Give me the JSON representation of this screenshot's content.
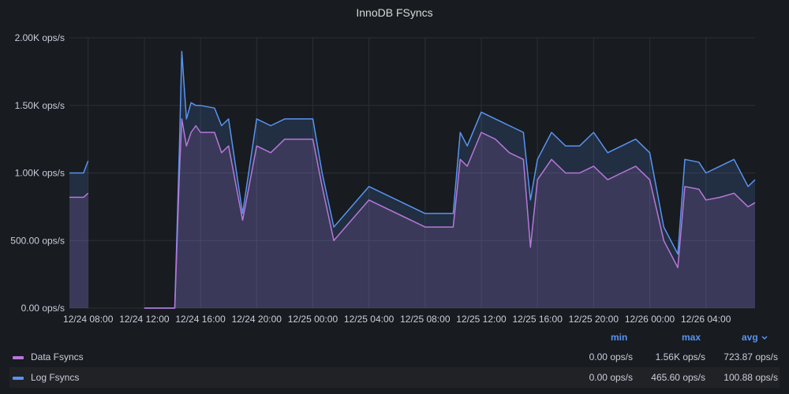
{
  "panel": {
    "title": "InnoDB FSyncs"
  },
  "legend": {
    "headers": {
      "min": "min",
      "max": "max",
      "avg": "avg",
      "avg_icon": "chevron-down-icon"
    },
    "rows": [
      {
        "name": "Data Fsyncs",
        "color": "#b877d9",
        "min": "0.00 ops/s",
        "max": "1.56K ops/s",
        "avg": "723.87 ops/s"
      },
      {
        "name": "Log Fsyncs",
        "color": "#5794f2",
        "min": "0.00 ops/s",
        "max": "465.60 ops/s",
        "avg": "100.88 ops/s"
      }
    ]
  },
  "chart_data": {
    "type": "area",
    "title": "InnoDB FSyncs",
    "y_tick_labels": [
      "0.00 ops/s",
      "500.00 ops/s",
      "1.00K ops/s",
      "1.50K ops/s",
      "2.00K ops/s"
    ],
    "ylim": [
      0,
      2000
    ],
    "x_range": [
      "12/24 06:40",
      "12/26 07:30"
    ],
    "x_tick_labels": [
      "12/24 08:00",
      "12/24 12:00",
      "12/24 16:00",
      "12/24 20:00",
      "12/25 00:00",
      "12/25 04:00",
      "12/25 08:00",
      "12/25 12:00",
      "12/25 16:00",
      "12/25 20:00",
      "12/26 00:00",
      "12/26 04:00"
    ],
    "grid": true,
    "legend_position": "bottom",
    "series": [
      {
        "name": "Log Fsyncs",
        "color": "#5794f2",
        "x": [
          "12/24 06:40",
          "12/24 07:40",
          "12/24 08:00",
          "12/24 08:20",
          "12/24 12:00",
          "12/24 14:10",
          "12/24 14:30",
          "12/24 14:40",
          "12/24 15:00",
          "12/24 15:20",
          "12/24 15:40",
          "12/24 16:00",
          "12/24 17:00",
          "12/24 17:30",
          "12/24 18:00",
          "12/24 19:00",
          "12/24 20:00",
          "12/24 21:00",
          "12/24 22:00",
          "12/24 23:00",
          "12/25 00:00",
          "12/25 00:40",
          "12/25 01:30",
          "12/25 04:00",
          "12/25 08:00",
          "12/25 10:00",
          "12/25 10:30",
          "12/25 11:00",
          "12/25 12:00",
          "12/25 13:00",
          "12/25 14:00",
          "12/25 15:00",
          "12/25 15:30",
          "12/25 16:00",
          "12/25 17:00",
          "12/25 18:00",
          "12/25 19:00",
          "12/25 20:00",
          "12/25 21:00",
          "12/25 22:00",
          "12/25 23:00",
          "12/26 00:00",
          "12/26 01:00",
          "12/26 02:00",
          "12/26 02:30",
          "12/26 03:30",
          "12/26 04:00",
          "12/26 05:00",
          "12/26 06:00",
          "12/26 07:00",
          "12/26 07:30"
        ],
        "y": [
          1000,
          1000,
          1090,
          null,
          0,
          0,
          1200,
          1900,
          1400,
          1520,
          1500,
          1500,
          1480,
          1350,
          1400,
          700,
          1400,
          1350,
          1400,
          1400,
          1400,
          1000,
          600,
          900,
          700,
          700,
          1300,
          1200,
          1450,
          1400,
          1350,
          1300,
          800,
          1100,
          1300,
          1200,
          1200,
          1300,
          1150,
          1200,
          1250,
          1150,
          600,
          400,
          1100,
          1080,
          1000,
          1050,
          1100,
          900,
          950
        ]
      },
      {
        "name": "Data Fsyncs",
        "color": "#b877d9",
        "x": [
          "12/24 06:40",
          "12/24 07:40",
          "12/24 08:00",
          "12/24 08:20",
          "12/24 12:00",
          "12/24 14:10",
          "12/24 14:30",
          "12/24 14:40",
          "12/24 15:00",
          "12/24 15:20",
          "12/24 15:40",
          "12/24 16:00",
          "12/24 17:00",
          "12/24 17:30",
          "12/24 18:00",
          "12/24 19:00",
          "12/24 20:00",
          "12/24 21:00",
          "12/24 22:00",
          "12/24 23:00",
          "12/25 00:00",
          "12/25 00:40",
          "12/25 01:30",
          "12/25 04:00",
          "12/25 08:00",
          "12/25 10:00",
          "12/25 10:30",
          "12/25 11:00",
          "12/25 12:00",
          "12/25 13:00",
          "12/25 14:00",
          "12/25 15:00",
          "12/25 15:30",
          "12/25 16:00",
          "12/25 17:00",
          "12/25 18:00",
          "12/25 19:00",
          "12/25 20:00",
          "12/25 21:00",
          "12/25 22:00",
          "12/25 23:00",
          "12/26 00:00",
          "12/26 01:00",
          "12/26 02:00",
          "12/26 02:30",
          "12/26 03:30",
          "12/26 04:00",
          "12/26 05:00",
          "12/26 06:00",
          "12/26 07:00",
          "12/26 07:30"
        ],
        "y": [
          820,
          820,
          850,
          null,
          0,
          0,
          1000,
          1400,
          1200,
          1300,
          1350,
          1300,
          1300,
          1150,
          1200,
          650,
          1200,
          1150,
          1250,
          1250,
          1250,
          900,
          500,
          800,
          600,
          600,
          1100,
          1050,
          1300,
          1250,
          1150,
          1100,
          450,
          950,
          1100,
          1000,
          1000,
          1050,
          950,
          1000,
          1050,
          950,
          500,
          300,
          900,
          880,
          800,
          820,
          850,
          750,
          780
        ]
      }
    ]
  }
}
